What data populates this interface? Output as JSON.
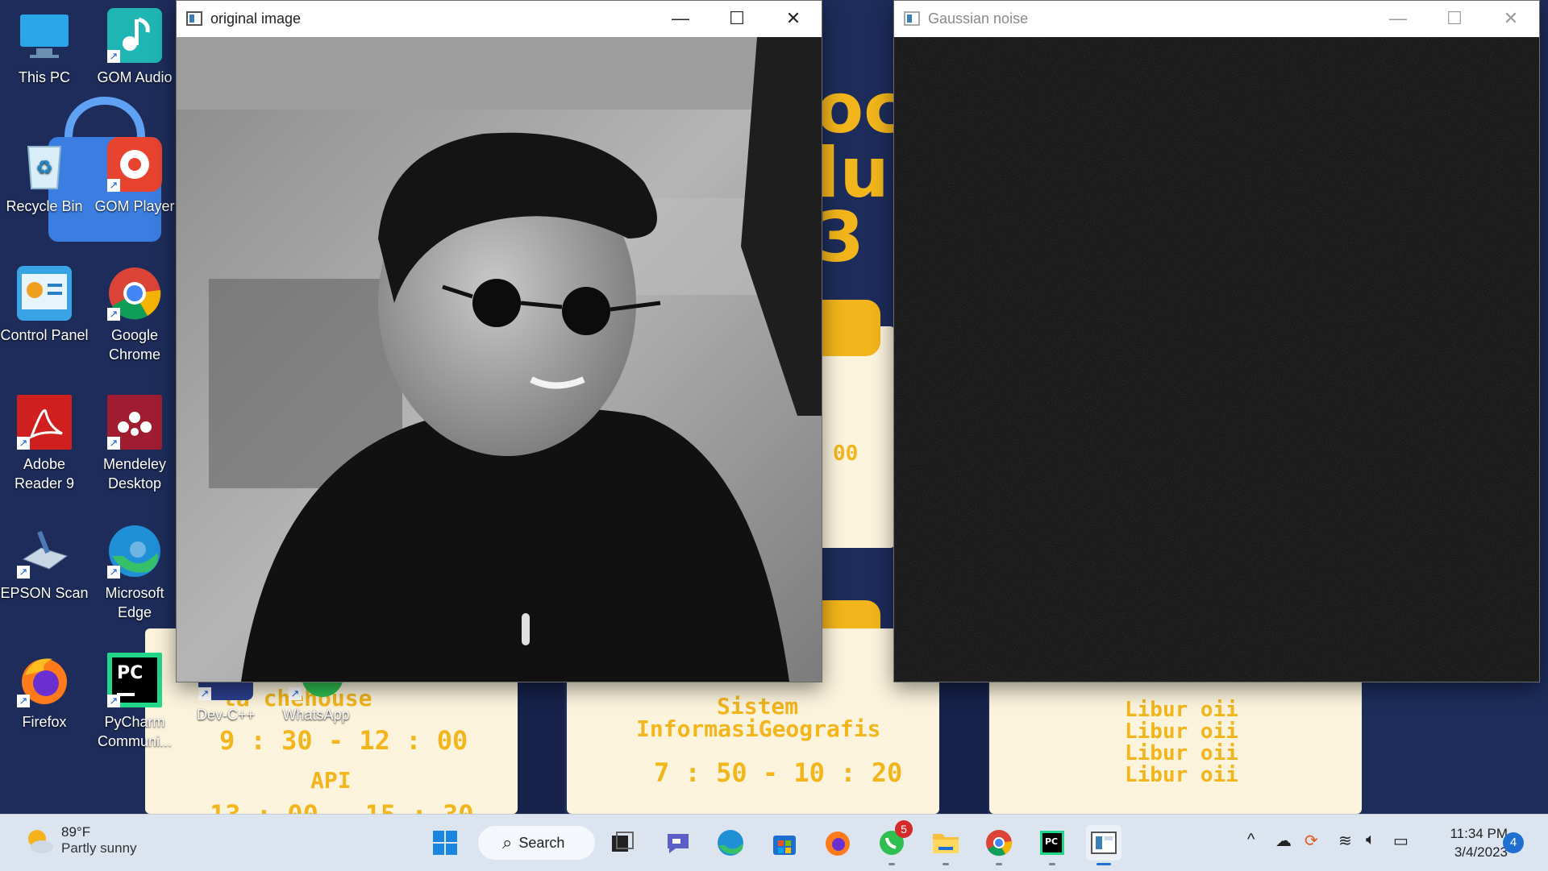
{
  "desktop": {
    "icons": [
      {
        "label": "This PC"
      },
      {
        "label": "GOM Audio"
      },
      {
        "label": "Recycle Bin"
      },
      {
        "label": "GOM Player"
      },
      {
        "label": "Control Panel"
      },
      {
        "label": "Google Chrome"
      },
      {
        "label": "Adobe Reader 9"
      },
      {
        "label": "Mendeley Desktop"
      },
      {
        "label": "EPSON Scan"
      },
      {
        "label": "Microsoft Edge"
      },
      {
        "label": "Firefox"
      },
      {
        "label": "PyCharm Communi..."
      },
      {
        "label": "Dev-C++"
      },
      {
        "label": "WhatsApp"
      }
    ]
  },
  "wallpaper": {
    "big_text": [
      "oc",
      "lu",
      "3"
    ],
    "card1": {
      "line1": "ta  chehouse",
      "time1": "9 : 30 - 12 : 00",
      "line2": "API",
      "time2": "13 : 00 - 15 : 30"
    },
    "card2": {
      "title1": "Sistem",
      "title2": "InformasiGeografis",
      "time": "7 : 50 - 10 : 20"
    },
    "card3": {
      "lines": [
        "Libur oii",
        "Libur oii",
        "Libur oii",
        "Libur oii"
      ]
    },
    "small_text": "00"
  },
  "windows": {
    "original": {
      "title": "original image"
    },
    "gaussian": {
      "title": "Gaussian noise"
    }
  },
  "taskbar": {
    "weather": {
      "temp": "89°F",
      "condition": "Partly sunny"
    },
    "search_label": "Search",
    "whatsapp_badge": "5",
    "clock": {
      "time": "11:34 PM",
      "date": "3/4/2023"
    },
    "notification_count": "4"
  },
  "colors": {
    "accent": "#f2b51b",
    "wallpaper_bg": "#1d2c5a",
    "card": "#fbf3dc",
    "taskbar": "#dbe4ef"
  }
}
